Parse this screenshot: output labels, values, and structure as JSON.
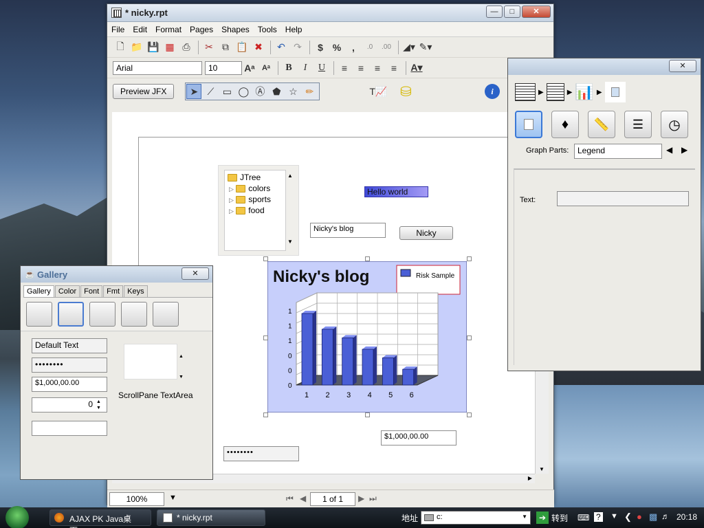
{
  "main": {
    "title": "* nicky.rpt",
    "menu": [
      "File",
      "Edit",
      "Format",
      "Pages",
      "Shapes",
      "Tools",
      "Help"
    ],
    "font_name": "Arial",
    "font_size": "10",
    "preview_button": "Preview JFX",
    "tree": {
      "root": "JTree",
      "items": [
        "colors",
        "sports",
        "food"
      ]
    },
    "hello_label": "Hello world",
    "blog_field": "Nicky's blog",
    "nicky_button": "Nicky",
    "money_field": "$1,000,00.00",
    "password_field": "••••••••",
    "zoom": "100%",
    "page_indicator": "1 of 1"
  },
  "chart_data": {
    "type": "bar",
    "title": "Nicky's blog",
    "categories": [
      "1",
      "2",
      "3",
      "4",
      "5",
      "6"
    ],
    "series": [
      {
        "name": "Risk Sample",
        "values": [
          1.0,
          0.78,
          0.66,
          0.5,
          0.38,
          0.22
        ]
      }
    ],
    "yticks": [
      "0",
      "0",
      "0",
      "1",
      "1",
      "1"
    ],
    "legend": "top-right",
    "colors": {
      "bar": "#4a5fd6",
      "background": "#c7cffb"
    }
  },
  "gallery": {
    "title": "Gallery",
    "tabs": [
      "Gallery",
      "Color",
      "Font",
      "Fmt",
      "Keys"
    ],
    "default_text": "Default Text",
    "password": "••••••••",
    "money": "$1,000,00.00",
    "spinner": "0",
    "scroll_label": "ScrollPane TextArea"
  },
  "graph_panel": {
    "graph_parts_label": "Graph Parts:",
    "graph_parts_value": "Legend",
    "text_label": "Text:"
  },
  "taskbar": {
    "task1": "AJAX PK Java桌面...",
    "task2": "* nicky.rpt",
    "address_label": "地址",
    "address_value": "c:",
    "go_label": "转到",
    "clock": "20:18"
  }
}
